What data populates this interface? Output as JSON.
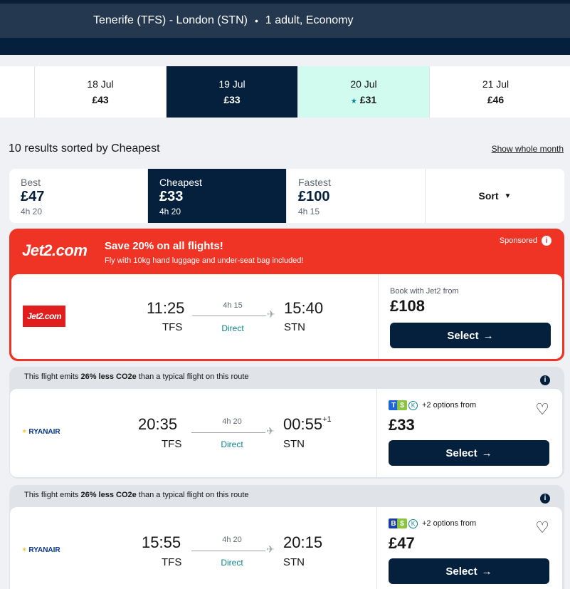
{
  "header": {
    "route": "Tenerife (TFS) - London (STN)",
    "separator": "•",
    "travellers": "1 adult, Economy"
  },
  "dates": [
    {
      "date": "18 Jul",
      "price": "£43"
    },
    {
      "date": "19 Jul",
      "price": "£33"
    },
    {
      "date": "20 Jul",
      "price": "£31",
      "star": "★"
    },
    {
      "date": "21 Jul",
      "price": "£46"
    }
  ],
  "results": {
    "summary": "10 results sorted by Cheapest",
    "show_month": "Show whole month"
  },
  "sort_tabs": [
    {
      "label": "Best",
      "price": "£47",
      "duration": "4h 20"
    },
    {
      "label": "Cheapest",
      "price": "£33",
      "duration": "4h 20"
    },
    {
      "label": "Fastest",
      "price": "£100",
      "duration": "4h 15"
    }
  ],
  "sort_button": {
    "label": "Sort",
    "caret": "▼"
  },
  "sponsored": {
    "logo_text": "Jet2.com",
    "headline": "Save 20% on all flights!",
    "subline": "Fly with 10kg hand luggage and under-seat bag included!",
    "tag": "Sponsored",
    "info": "i",
    "flight": {
      "logo_text": "Jet2.com",
      "dep_time": "11:25",
      "dep_code": "TFS",
      "duration": "4h 15",
      "stops": "Direct",
      "arr_time": "15:40",
      "arr_code": "STN",
      "book_from": "Book with Jet2 from",
      "price": "£108",
      "select": "Select",
      "arrow": "→"
    }
  },
  "flights": [
    {
      "co2_prefix": "This flight emits ",
      "co2_bold": "26% less CO2e",
      "co2_suffix": " than a typical flight on this route",
      "airline": "RYANAIR",
      "dep_time": "20:35",
      "dep_code": "TFS",
      "duration": "4h 20",
      "stops": "Direct",
      "arr_time": "00:55",
      "arr_plus": "+1",
      "arr_code": "STN",
      "icon_letter": "T",
      "options": "+2 options from",
      "price": "£33",
      "select": "Select",
      "arrow": "→"
    },
    {
      "co2_prefix": "This flight emits ",
      "co2_bold": "26% less CO2e",
      "co2_suffix": " than a typical flight on this route",
      "airline": "RYANAIR",
      "dep_time": "15:55",
      "dep_code": "TFS",
      "duration": "4h 20",
      "stops": "Direct",
      "arr_time": "20:15",
      "arr_plus": "",
      "arr_code": "STN",
      "icon_letter": "B",
      "options": "+2 options from",
      "price": "£47",
      "select": "Select",
      "arrow": "→"
    }
  ],
  "colors": {
    "navy": "#05203c",
    "jet2_red": "#ef3324",
    "best_date": "#d0fbee",
    "teal": "#0c838a"
  },
  "icons": {
    "plane": "✈",
    "heart": "♡",
    "harp": "✶",
    "circle_k": "K",
    "dollar_g": "$"
  }
}
